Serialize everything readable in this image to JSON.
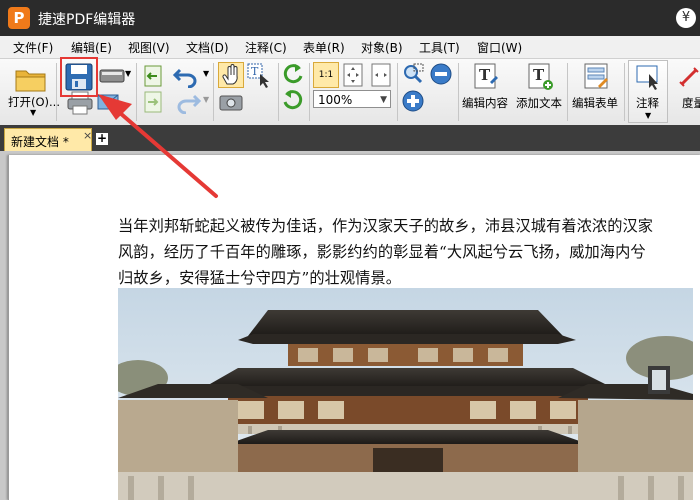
{
  "titlebar": {
    "logo": "P",
    "title": "捷速PDF编辑器",
    "right_glyph": "¥"
  },
  "menu": [
    "文件(F)",
    "编辑(E)",
    "视图(V)",
    "文档(D)",
    "注释(C)",
    "表单(R)",
    "对象(B)",
    "工具(T)",
    "窗口(W)"
  ],
  "toolbar": {
    "open_label": "打开(O)...",
    "zoom_value": "100%",
    "edit_content_label": "编辑内容",
    "add_text_label": "添加文本",
    "edit_form_label": "编辑表单",
    "annotate_label": "注释",
    "partial_label": "度量"
  },
  "tabs": {
    "active_label": "新建文档 *",
    "close_glyph": "×",
    "new_glyph": "+"
  },
  "document": {
    "lines": [
      "当年刘邦斩蛇起义被传为佳话，作为汉家天子的故乡，沛县汉城有着浓浓的汉家",
      "风韵，经历了千百年的雕琢，影影约约的彰显着“大风起兮云飞扬，威加海内兮",
      "归故乡，安得猛士兮守四方”的壮观情景。"
    ]
  },
  "colors": {
    "accent": "#f07a1a",
    "highlight": "#e53935",
    "tab_active": "#ffe9a8"
  },
  "icons": [
    "folder-open-icon",
    "save-icon",
    "print-icon",
    "scanner-icon",
    "email-icon",
    "undo-icon",
    "redo-icon",
    "hand-icon",
    "select-text-icon",
    "snapshot-icon",
    "rotate-icon",
    "actual-size-icon",
    "fit-page-icon",
    "fit-width-icon",
    "zoom-in-icon",
    "zoom-out-icon",
    "edit-content-icon",
    "add-text-icon",
    "edit-form-icon",
    "annotate-icon"
  ]
}
